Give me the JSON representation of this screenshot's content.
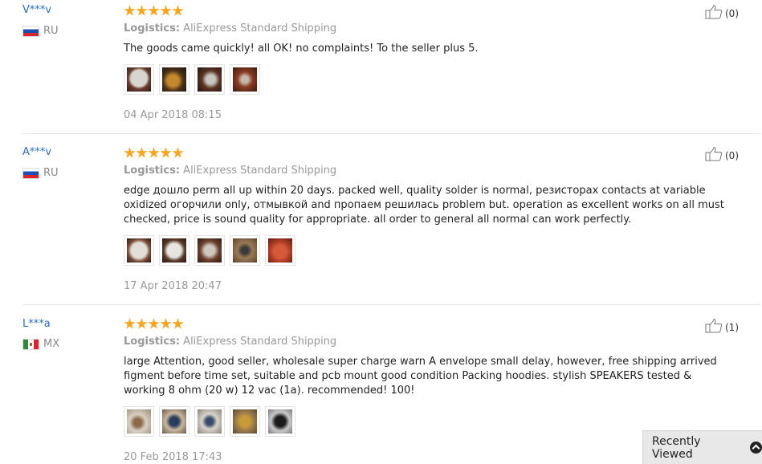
{
  "reviews": [
    {
      "user": "V***v",
      "country": "RU",
      "flag": "flag-ru",
      "stars": 5,
      "logistics_label": "Logistics:",
      "logistics_value": "AliExpress Standard Shipping",
      "text": "The goods came quickly! all OK! no complaints! To the seller plus 5.",
      "photos": 4,
      "date": "04 Apr 2018 08:15",
      "useful_count": "(0)"
    },
    {
      "user": "A***v",
      "country": "RU",
      "flag": "flag-ru",
      "stars": 5,
      "logistics_label": "Logistics:",
      "logistics_value": "AliExpress Standard Shipping",
      "text": "edge дошло perm all up within 20 days. packed well, quality solder is normal, резисторах contacts at variable oxidized огорчили only, отмывкой and пропаем решилась problem but. operation as excellent works on all must checked, price is sound quality for appropriate. all order to general all normal can work perfectly.",
      "photos": 5,
      "date": "17 Apr 2018 20:47",
      "useful_count": "(0)"
    },
    {
      "user": "L***a",
      "country": "MX",
      "flag": "flag-mx",
      "stars": 5,
      "logistics_label": "Logistics:",
      "logistics_value": "AliExpress Standard Shipping",
      "text": "large Attention, good seller, wholesale super charge warn A envelope small delay, however, free shipping arrived figment before time set, suitable and pcb mount good condition Packing hoodies. stylish SPEAKERS tested & working 8 ohm (20 w) 12 vac (1a). recommended! 100!",
      "photos": 5,
      "date": "20 Feb 2018 17:43",
      "useful_count": "(1)"
    }
  ],
  "recently_viewed": {
    "label": "Recently Viewed"
  },
  "colors": {
    "star": "#f5a623",
    "username": "#2a6ebb"
  }
}
